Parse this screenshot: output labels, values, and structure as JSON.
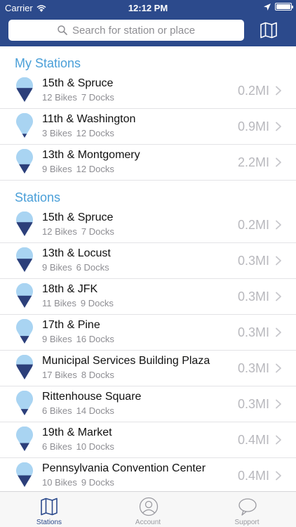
{
  "status_bar": {
    "carrier": "Carrier",
    "time": "12:12 PM"
  },
  "search": {
    "placeholder": "Search for station or place"
  },
  "sections": [
    {
      "title": "My Stations",
      "stations": [
        {
          "name": "15th & Spruce",
          "bikes": "12 Bikes",
          "docks": "7 Docks",
          "distance": "0.2MI",
          "fill": 0.63
        },
        {
          "name": "11th & Washington",
          "bikes": "3 Bikes",
          "docks": "12 Docks",
          "distance": "0.9MI",
          "fill": 0.2
        },
        {
          "name": "13th & Montgomery",
          "bikes": "9 Bikes",
          "docks": "12 Docks",
          "distance": "2.2MI",
          "fill": 0.43
        }
      ]
    },
    {
      "title": "Stations",
      "stations": [
        {
          "name": "15th & Spruce",
          "bikes": "12 Bikes",
          "docks": "7 Docks",
          "distance": "0.2MI",
          "fill": 0.63
        },
        {
          "name": "13th & Locust",
          "bikes": "9 Bikes",
          "docks": "6 Docks",
          "distance": "0.3MI",
          "fill": 0.6
        },
        {
          "name": "18th & JFK",
          "bikes": "11 Bikes",
          "docks": "9 Docks",
          "distance": "0.3MI",
          "fill": 0.55
        },
        {
          "name": "17th & Pine",
          "bikes": "9 Bikes",
          "docks": "16 Docks",
          "distance": "0.3MI",
          "fill": 0.36
        },
        {
          "name": "Municipal Services Building Plaza",
          "bikes": "17 Bikes",
          "docks": "8 Docks",
          "distance": "0.3MI",
          "fill": 0.68
        },
        {
          "name": "Rittenhouse Square",
          "bikes": "6 Bikes",
          "docks": "14 Docks",
          "distance": "0.3MI",
          "fill": 0.3
        },
        {
          "name": "19th & Market",
          "bikes": "6 Bikes",
          "docks": "10 Docks",
          "distance": "0.4MI",
          "fill": 0.38
        },
        {
          "name": "Pennsylvania Convention Center",
          "bikes": "10 Bikes",
          "docks": "9 Docks",
          "distance": "0.4MI",
          "fill": 0.53
        }
      ]
    }
  ],
  "tabs": [
    {
      "label": "Stations",
      "icon": "map-icon",
      "active": true
    },
    {
      "label": "Account",
      "icon": "user-icon",
      "active": false
    },
    {
      "label": "Support",
      "icon": "chat-bubble-icon",
      "active": false
    }
  ],
  "colors": {
    "nav": "#2c4a8c",
    "accent": "#4a9fd8",
    "pin_light": "#a9d4f2",
    "pin_dark": "#2c3f7a"
  }
}
